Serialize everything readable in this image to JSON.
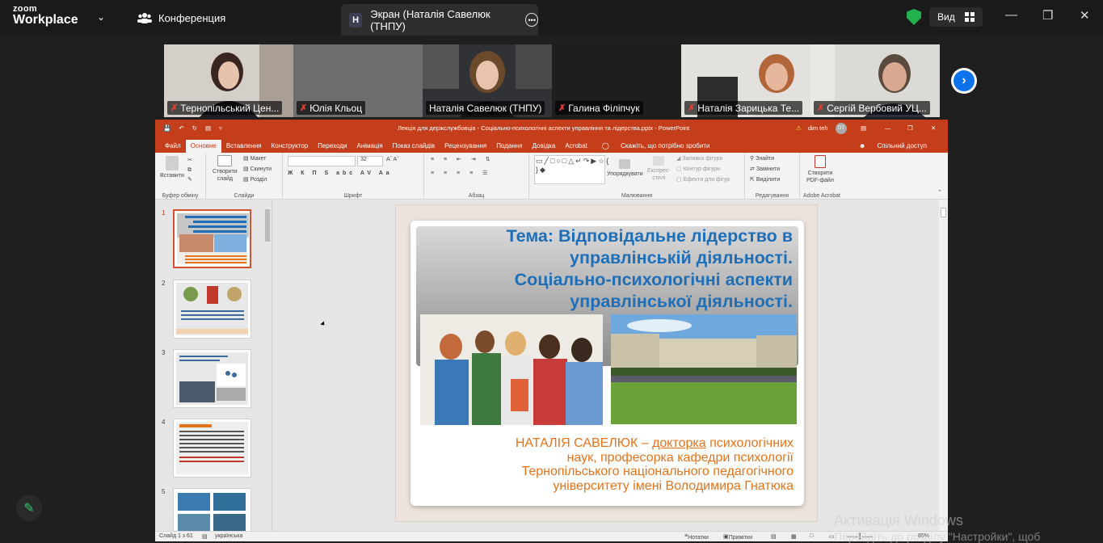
{
  "top_bar": {
    "brand_line1": "zoom",
    "brand_line2": "Workplace",
    "conference_label": "Конференция",
    "screen_badge": "Н",
    "screen_tab_label": "Экран (Наталія Савелюк (ТНПУ)",
    "view_label": "Вид"
  },
  "participants": [
    {
      "name": "Тернопільський Цен..."
    },
    {
      "name": "Юлія Кльоц"
    },
    {
      "name": "Наталія Савелюк (ТНПУ)"
    },
    {
      "name": "Галина Філіпчук"
    },
    {
      "name": "Наталія Зарицька Те..."
    },
    {
      "name": "Сергій Вербовий УЦ..."
    }
  ],
  "powerpoint": {
    "file_title": "Лекція для держслужбовців - Соціально-психологічні аспекти управління та лідерства.pptx  -  PowerPoint",
    "user": "dim teh",
    "user_initials": "DT",
    "tabs": [
      "Файл",
      "Основне",
      "Вставлення",
      "Конструктор",
      "Переходи",
      "Анімація",
      "Показ слайдів",
      "Рецензування",
      "Подання",
      "Довідка",
      "Acrobat"
    ],
    "tell_me": "Скажіть, що потрібно зробити",
    "share": "Спільний доступ",
    "ribbon": {
      "paste": "Вставити",
      "clipboard": "Буфер обміну",
      "new_slide_1": "Створити",
      "new_slide_2": "слайд",
      "layout": "Макет",
      "reset": "Скинути",
      "section": "Розділ",
      "slides": "Слайди",
      "font_size": "32",
      "font": "Шрифт",
      "paragraph": "Абзац",
      "arrange": "Упорядкувати",
      "quick_styles_1": "Експрес-",
      "quick_styles_2": "стилі",
      "fill": "Заливка фігури",
      "outline": "Контур фігури",
      "effects": "Ефекти для фігур",
      "drawing": "Малювання",
      "find": "Знайти",
      "replace": "Замінити",
      "select": "Виділити",
      "editing": "Редагування",
      "create_pdf_1": "Створити",
      "create_pdf_2": "PDF-файл",
      "adobe": "Adobe Acrobat"
    },
    "thumb_numbers": [
      "1",
      "2",
      "3",
      "4",
      "5"
    ],
    "slide": {
      "title_lines": [
        "Тема: Відповідальне лідерство в",
        "управлінській діяльності.",
        "Соціально-психологічні аспекти",
        "управлінської діяльності."
      ],
      "author_a": "НАТАЛІЯ САВЕЛЮК – ",
      "author_b": "докторка",
      "author_c": " психологічних",
      "author_lines": [
        "наук, професорка кафедри психології",
        "Тернопільського національного педагогічного",
        "університету імені Володимира Гнатюка"
      ]
    },
    "status": {
      "slide_count": "Слайд 1 з 61",
      "language": "українська",
      "notes": "Нотатки",
      "comments": "Примітки",
      "zoom": "85%"
    }
  },
  "watermark": {
    "line1": "Активація Windows",
    "line2": "Перейдіть до розділу \"Настройки\", щоб"
  }
}
